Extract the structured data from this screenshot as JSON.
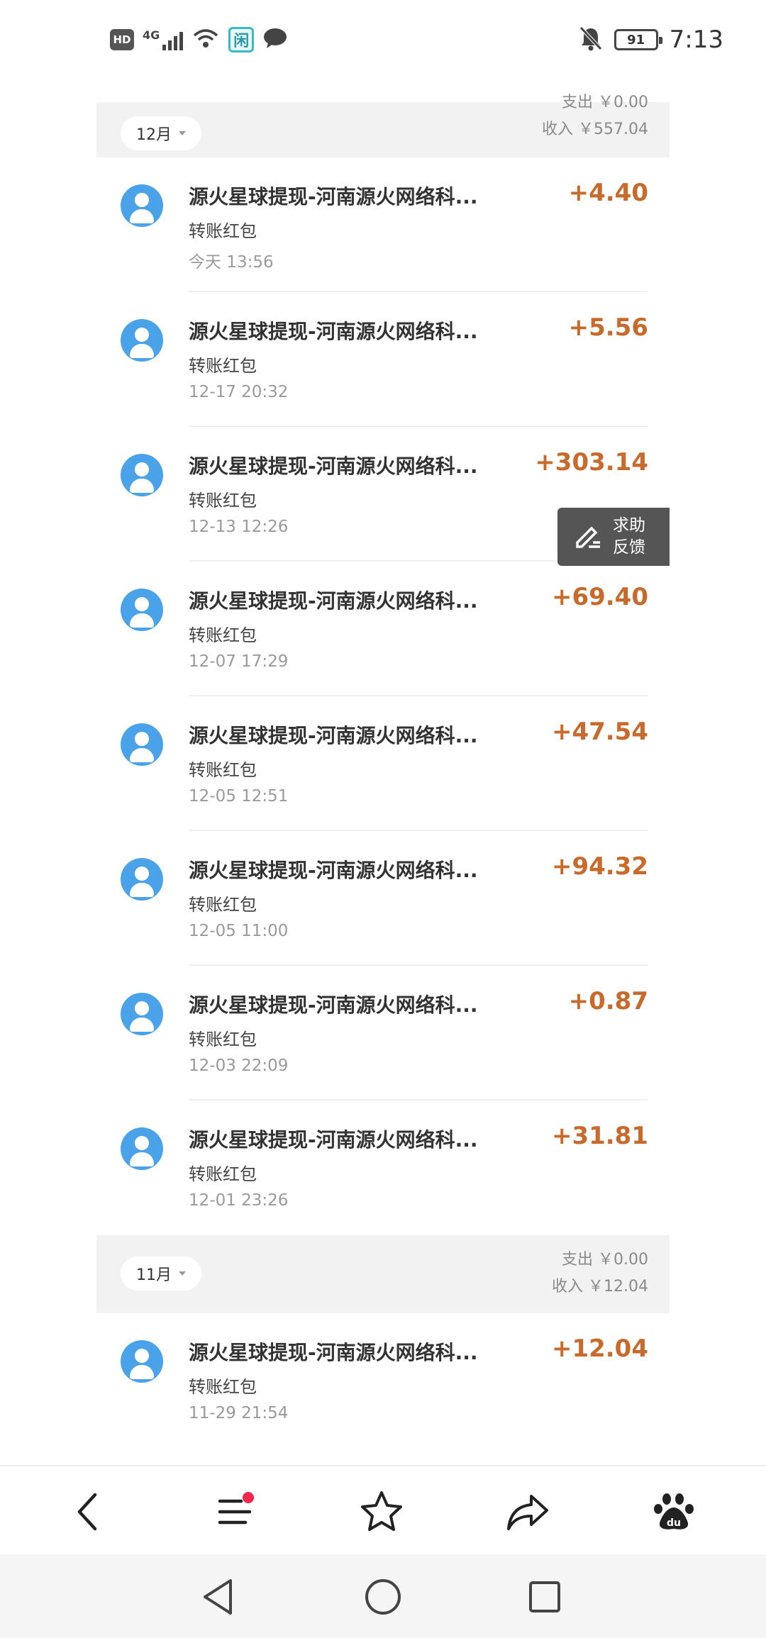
{
  "status_bar": {
    "hd_label": "HD",
    "network_label": "4G",
    "app_badge": "闲",
    "battery_level": "91",
    "time": "7:13"
  },
  "sections": [
    {
      "month": "12月",
      "expense_label": "支出 ￥0.00",
      "income_label": "收入 ￥557.04",
      "transactions": [
        {
          "name": "源火星球提现-河南源火网络科...",
          "type": "转账红包",
          "time": "今天 13:56",
          "amount": "+4.40"
        },
        {
          "name": "源火星球提现-河南源火网络科...",
          "type": "转账红包",
          "time": "12-17 20:32",
          "amount": "+5.56"
        },
        {
          "name": "源火星球提现-河南源火网络科...",
          "type": "转账红包",
          "time": "12-13 12:26",
          "amount": "+303.14"
        },
        {
          "name": "源火星球提现-河南源火网络科...",
          "type": "转账红包",
          "time": "12-07 17:29",
          "amount": "+69.40"
        },
        {
          "name": "源火星球提现-河南源火网络科...",
          "type": "转账红包",
          "time": "12-05 12:51",
          "amount": "+47.54"
        },
        {
          "name": "源火星球提现-河南源火网络科...",
          "type": "转账红包",
          "time": "12-05 11:00",
          "amount": "+94.32"
        },
        {
          "name": "源火星球提现-河南源火网络科...",
          "type": "转账红包",
          "time": "12-03 22:09",
          "amount": "+0.87"
        },
        {
          "name": "源火星球提现-河南源火网络科...",
          "type": "转账红包",
          "time": "12-01 23:26",
          "amount": "+31.81"
        }
      ]
    },
    {
      "month": "11月",
      "expense_label": "支出 ￥0.00",
      "income_label": "收入 ￥12.04",
      "transactions": [
        {
          "name": "源火星球提现-河南源火网络科...",
          "type": "转账红包",
          "time": "11-29 21:54",
          "amount": "+12.04"
        }
      ]
    }
  ],
  "feedback": {
    "line1": "求助",
    "line2": "反馈"
  },
  "toolbar": {
    "icons": [
      "back-icon",
      "menu-icon",
      "star-icon",
      "share-icon",
      "baidu-paw-icon"
    ]
  },
  "navbar": {
    "icons": [
      "nav-back-icon",
      "nav-home-icon",
      "nav-recents-icon"
    ]
  },
  "colors": {
    "amount": "#c86a2c",
    "avatar": "#4aa3e8",
    "notification_dot": "#f0294b"
  }
}
